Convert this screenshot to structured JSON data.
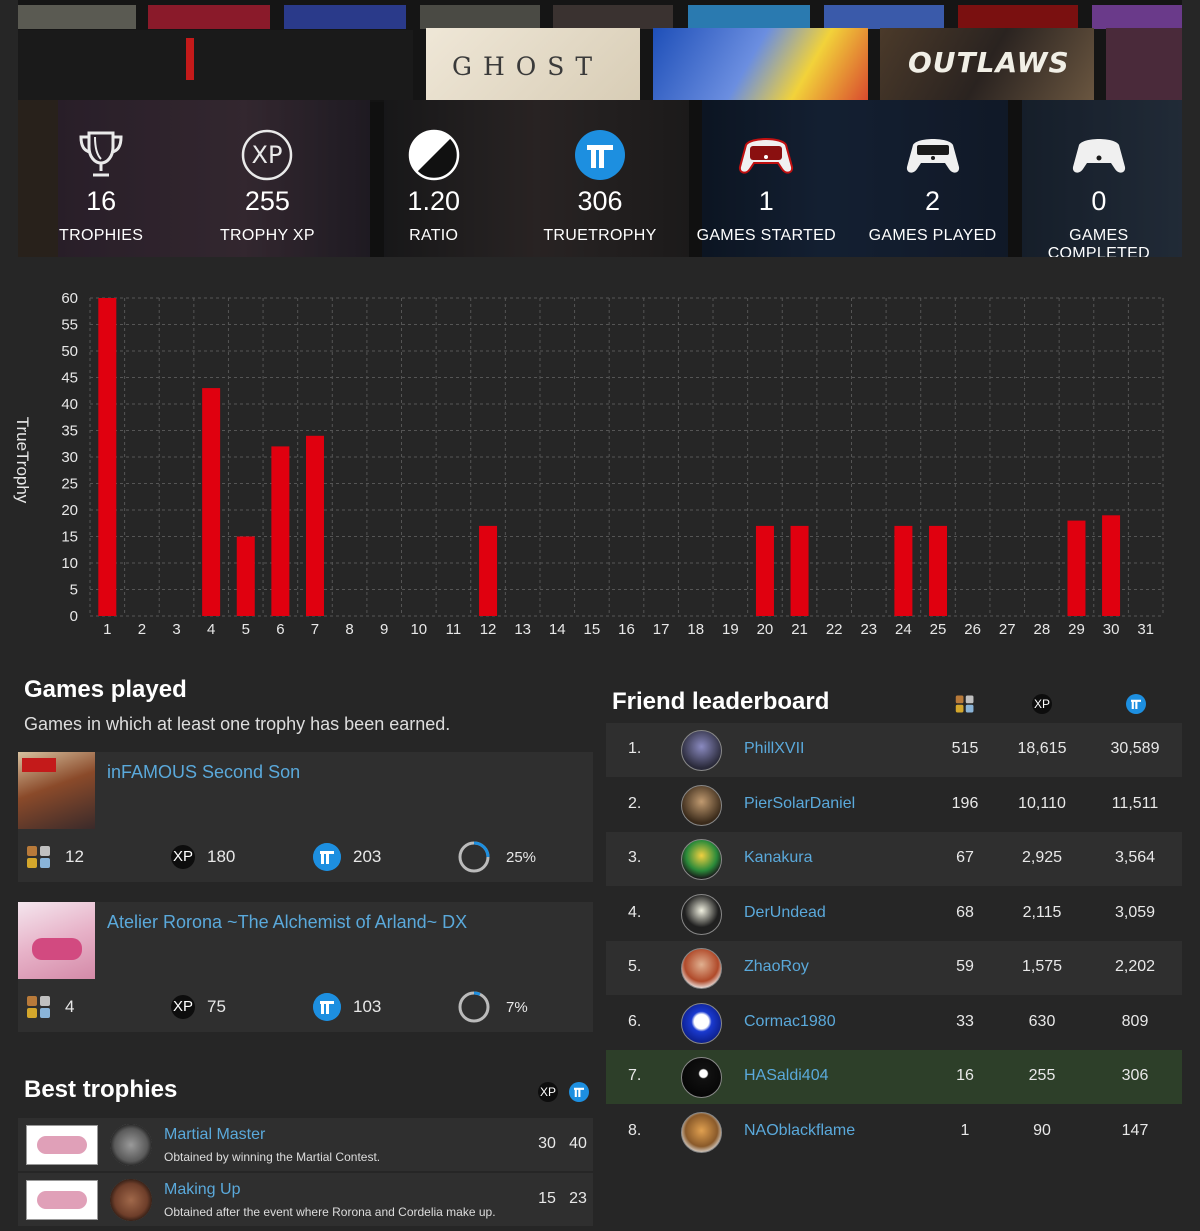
{
  "banner": {
    "tiles": [
      "GHOST",
      "OUTLAWS"
    ],
    "stats": [
      {
        "icon": "trophy-icon",
        "value": "16",
        "label": "TROPHIES"
      },
      {
        "icon": "xp-icon",
        "value": "255",
        "label": "TROPHY XP"
      },
      {
        "icon": "ratio-icon",
        "value": "1.20",
        "label": "RATIO"
      },
      {
        "icon": "truetrophy-icon",
        "value": "306",
        "label": "TRUETROPHY"
      },
      {
        "icon": "controller-started-icon",
        "value": "1",
        "label": "GAMES STARTED"
      },
      {
        "icon": "controller-played-icon",
        "value": "2",
        "label": "GAMES PLAYED"
      },
      {
        "icon": "controller-completed-icon",
        "value": "0",
        "label": "GAMES COMPLETED"
      }
    ]
  },
  "chart_data": {
    "type": "bar",
    "ylabel": "TrueTrophy",
    "xlabel": "",
    "title": "",
    "ylim": [
      0,
      60
    ],
    "yticks": [
      0,
      5,
      10,
      15,
      20,
      25,
      30,
      35,
      40,
      45,
      50,
      55,
      60
    ],
    "categories": [
      "1",
      "2",
      "3",
      "4",
      "5",
      "6",
      "7",
      "8",
      "9",
      "10",
      "11",
      "12",
      "13",
      "14",
      "15",
      "16",
      "17",
      "18",
      "19",
      "20",
      "21",
      "22",
      "23",
      "24",
      "25",
      "26",
      "27",
      "28",
      "29",
      "30",
      "31"
    ],
    "values": [
      60,
      0,
      0,
      43,
      15,
      32,
      34,
      0,
      0,
      0,
      0,
      17,
      0,
      0,
      0,
      0,
      0,
      0,
      0,
      17,
      17,
      0,
      0,
      17,
      17,
      0,
      0,
      0,
      18,
      19,
      0
    ],
    "bar_color": "#e0000f",
    "grid": true
  },
  "games": {
    "title": "Games played",
    "subtitle": "Games in which at least one trophy has been earned.",
    "items": [
      {
        "title": "inFAMOUS Second Son",
        "trophies": "12",
        "xp_label": "XP",
        "xp": "180",
        "truetrophy": "203",
        "completion": "25%",
        "completion_value": 0.25
      },
      {
        "title": "Atelier Rorona ~The Alchemist of Arland~ DX",
        "trophies": "4",
        "xp_label": "XP",
        "xp": "75",
        "truetrophy": "103",
        "completion": "7%",
        "completion_value": 0.07
      }
    ]
  },
  "best_trophies": {
    "title": "Best trophies",
    "xp_label": "XP",
    "items": [
      {
        "name": "Martial Master",
        "desc": "Obtained by winning the Martial Contest.",
        "xp": "30",
        "truetrophy": "40",
        "grade": "silver"
      },
      {
        "name": "Making Up",
        "desc": "Obtained after the event where Rorona and Cordelia make up.",
        "xp": "15",
        "truetrophy": "23",
        "grade": "bronze"
      }
    ]
  },
  "leaderboard": {
    "title": "Friend leaderboard",
    "xp_label": "XP",
    "rows": [
      {
        "rank": "1.",
        "name": "PhillXVII",
        "trophies": "515",
        "xp": "18,615",
        "truetrophy": "30,589"
      },
      {
        "rank": "2.",
        "name": "PierSolarDaniel",
        "trophies": "196",
        "xp": "10,110",
        "truetrophy": "11,511"
      },
      {
        "rank": "3.",
        "name": "Kanakura",
        "trophies": "67",
        "xp": "2,925",
        "truetrophy": "3,564"
      },
      {
        "rank": "4.",
        "name": "DerUndead",
        "trophies": "68",
        "xp": "2,115",
        "truetrophy": "3,059"
      },
      {
        "rank": "5.",
        "name": "ZhaoRoy",
        "trophies": "59",
        "xp": "1,575",
        "truetrophy": "2,202"
      },
      {
        "rank": "6.",
        "name": "Cormac1980",
        "trophies": "33",
        "xp": "630",
        "truetrophy": "809"
      },
      {
        "rank": "7.",
        "name": "HASaldi404",
        "trophies": "16",
        "xp": "255",
        "truetrophy": "306"
      },
      {
        "rank": "8.",
        "name": "NAOblackflame",
        "trophies": "1",
        "xp": "90",
        "truetrophy": "147"
      }
    ]
  }
}
